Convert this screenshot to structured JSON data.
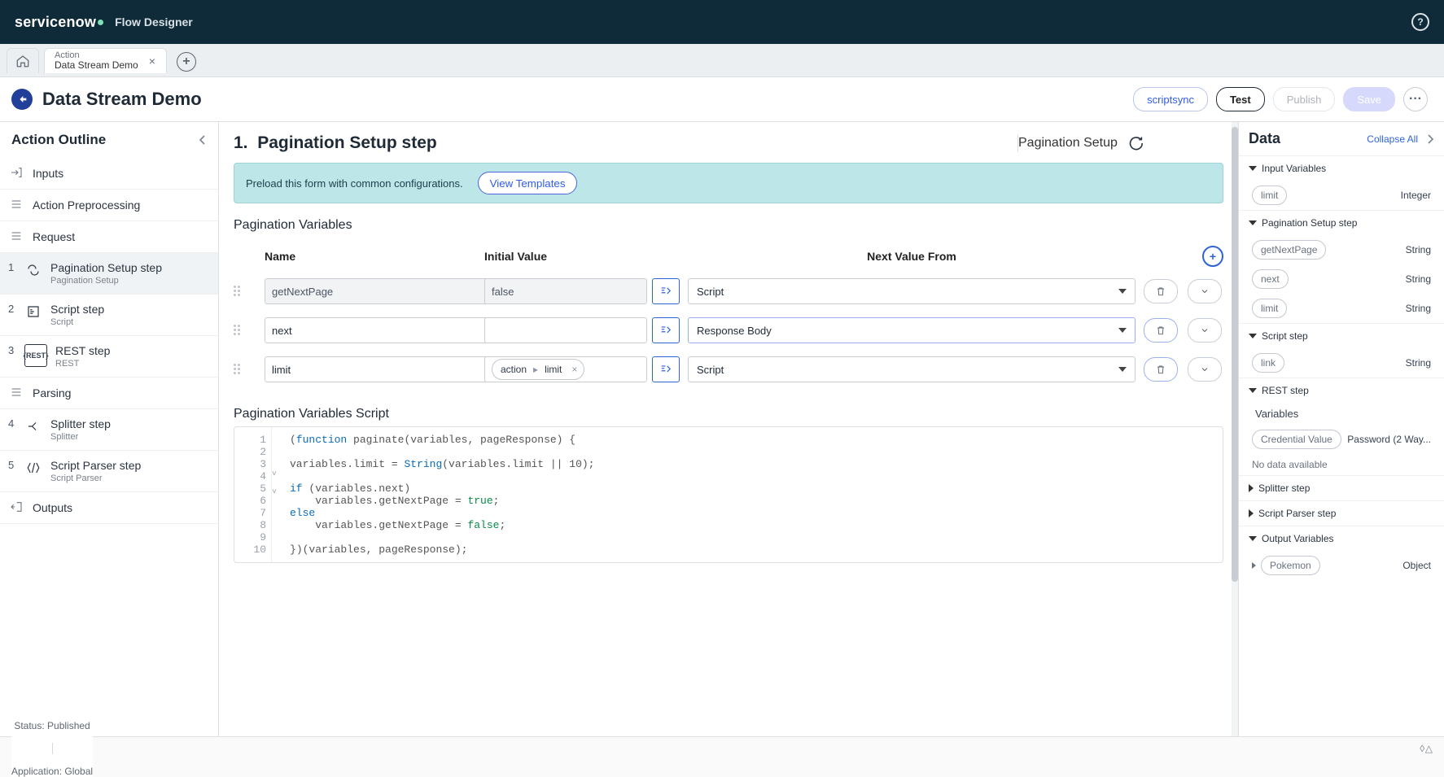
{
  "app": {
    "logo": "servicenow",
    "title": "Flow Designer"
  },
  "tabs": {
    "action_label": "Action",
    "action_name": "Data Stream Demo"
  },
  "header": {
    "page_title": "Data Stream Demo",
    "btn_scriptsync": "scriptsync",
    "btn_test": "Test",
    "btn_publish": "Publish",
    "btn_save": "Save"
  },
  "outline": {
    "title": "Action Outline",
    "inputs": "Inputs",
    "preprocessing": "Action Preprocessing",
    "request": "Request",
    "steps": [
      {
        "n": "1",
        "title": "Pagination Setup step",
        "sub": "Pagination Setup"
      },
      {
        "n": "2",
        "title": "Script step",
        "sub": "Script"
      },
      {
        "n": "3",
        "title": "REST step",
        "sub": "REST"
      }
    ],
    "parsing": "Parsing",
    "steps2": [
      {
        "n": "4",
        "title": "Splitter step",
        "sub": "Splitter"
      },
      {
        "n": "5",
        "title": "Script Parser step",
        "sub": "Script Parser"
      }
    ],
    "outputs": "Outputs"
  },
  "center": {
    "head_number": "1.",
    "head_title": "Pagination Setup step",
    "head_right": "Pagination Setup",
    "alert_text": "Preload this form with common configurations.",
    "alert_btn": "View Templates",
    "vars_title": "Pagination Variables",
    "cols": {
      "name": "Name",
      "initial": "Initial Value",
      "next": "Next Value From"
    },
    "rows": [
      {
        "name": "getNextPage",
        "initial_value": "false",
        "select": "Script",
        "name_disabled": true,
        "initial_disabled": true,
        "picker": false,
        "chip": null
      },
      {
        "name": "next",
        "initial_value": "",
        "select": "Response Body",
        "name_disabled": false,
        "initial_disabled": false,
        "picker": true,
        "chip": null
      },
      {
        "name": "limit",
        "initial_value": "",
        "select": "Script",
        "name_disabled": false,
        "initial_disabled": false,
        "picker": true,
        "chip": {
          "a": "action",
          "b": "limit"
        }
      }
    ],
    "script_title": "Pagination Variables Script",
    "code": {
      "lines": [
        "1",
        "2",
        "3",
        "4",
        "5",
        "6",
        "7",
        "8",
        "9",
        "10"
      ],
      "l1a": "(",
      "l1b": "function ",
      "l1c": "paginate(variables, pageResponse) {",
      "l3a": "variables.limit = ",
      "l3b": "String",
      "l3c": "(variables.limit || 10);",
      "l5a": "if ",
      "l5b": "(variables.next)",
      "l6a": "    variables.getNextPage = ",
      "l6b": "true",
      "l6c": ";",
      "l7a": "else",
      "l8a": "    variables.getNextPage = ",
      "l8b": "false",
      "l8c": ";",
      "l10a": "}",
      "l10b": ")(variables, pageResponse);"
    }
  },
  "data": {
    "title": "Data",
    "collapse": "Collapse All",
    "sections": {
      "input_vars": "Input Variables",
      "pagination": "Pagination Setup step",
      "script": "Script step",
      "rest": "REST step",
      "splitter": "Splitter step",
      "script_parser": "Script Parser step",
      "output": "Output Variables"
    },
    "input_vars": [
      {
        "name": "limit",
        "type": "Integer"
      }
    ],
    "pagination": [
      {
        "name": "getNextPage",
        "type": "String"
      },
      {
        "name": "next",
        "type": "String"
      },
      {
        "name": "limit",
        "type": "String"
      }
    ],
    "script": [
      {
        "name": "link",
        "type": "String"
      }
    ],
    "rest": {
      "variables_label": "Variables",
      "cred": {
        "name": "Credential Value",
        "type": "Password (2 Way..."
      },
      "no_data": "No data available"
    },
    "output": [
      {
        "name": "Pokemon",
        "type": "Object"
      }
    ]
  },
  "status": {
    "status": "Status: Published",
    "app": "Application: Global"
  }
}
